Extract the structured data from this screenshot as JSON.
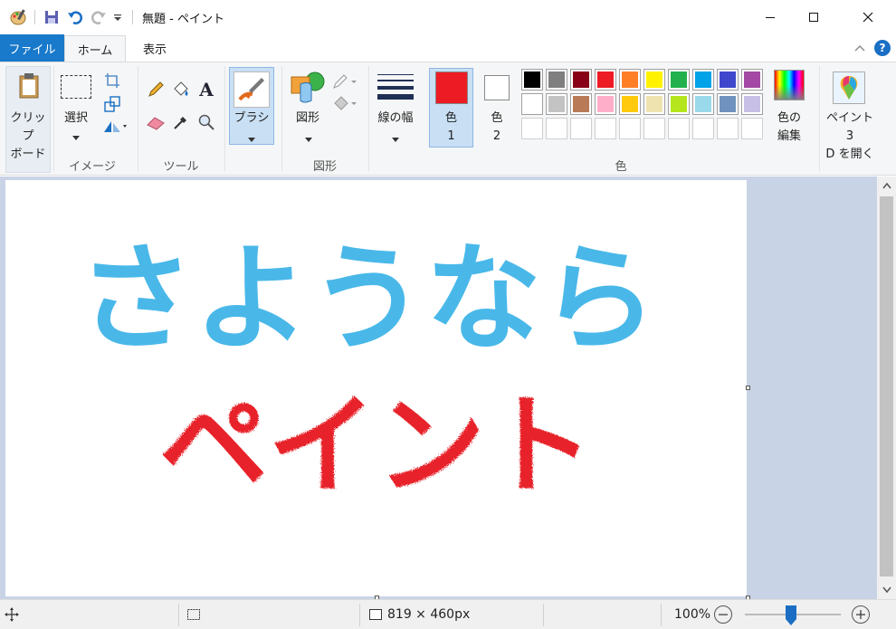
{
  "window": {
    "title": "無題 - ペイント"
  },
  "tabs": [
    {
      "label": "ファイル"
    },
    {
      "label": "ホーム"
    },
    {
      "label": "表示"
    }
  ],
  "ribbon": {
    "clipboard": {
      "label": "クリップ\nボード"
    },
    "image": {
      "select_label": "選択",
      "group_label": "イメージ"
    },
    "tools": {
      "group_label": "ツール"
    },
    "brush": {
      "label": "ブラシ"
    },
    "shapes": {
      "label": "図形",
      "group_label": "図形"
    },
    "size": {
      "label": "線の幅"
    },
    "color1": {
      "label": "色\n1",
      "value": "#ed1c24"
    },
    "color2": {
      "label": "色\n2",
      "value": "#ffffff"
    },
    "edit_colors": {
      "label": "色の\n編集"
    },
    "paint3d": {
      "label": "ペイント 3\nD を開く"
    },
    "colors_group_label": "色"
  },
  "palette": {
    "row1": [
      "#000000",
      "#7f7f7f",
      "#880015",
      "#ed1c24",
      "#ff7f27",
      "#fff200",
      "#22b14c",
      "#00a2e8",
      "#3f48cc",
      "#a349a4"
    ],
    "row2": [
      "#ffffff",
      "#c3c3c3",
      "#b97a57",
      "#ffaec9",
      "#ffc90e",
      "#efe4b0",
      "#b5e61d",
      "#99d9ea",
      "#7092be",
      "#c8bfe7"
    ],
    "row3": [
      "",
      "",
      "",
      "",
      "",
      "",
      "",
      "",
      "",
      ""
    ]
  },
  "canvas": {
    "text_line1": "さようなら",
    "text_line1_color": "#3fb4e8",
    "text_line2": "ペイント",
    "text_line2_color": "#e8232a"
  },
  "status": {
    "size": "819 × 460px",
    "zoom": "100%"
  }
}
